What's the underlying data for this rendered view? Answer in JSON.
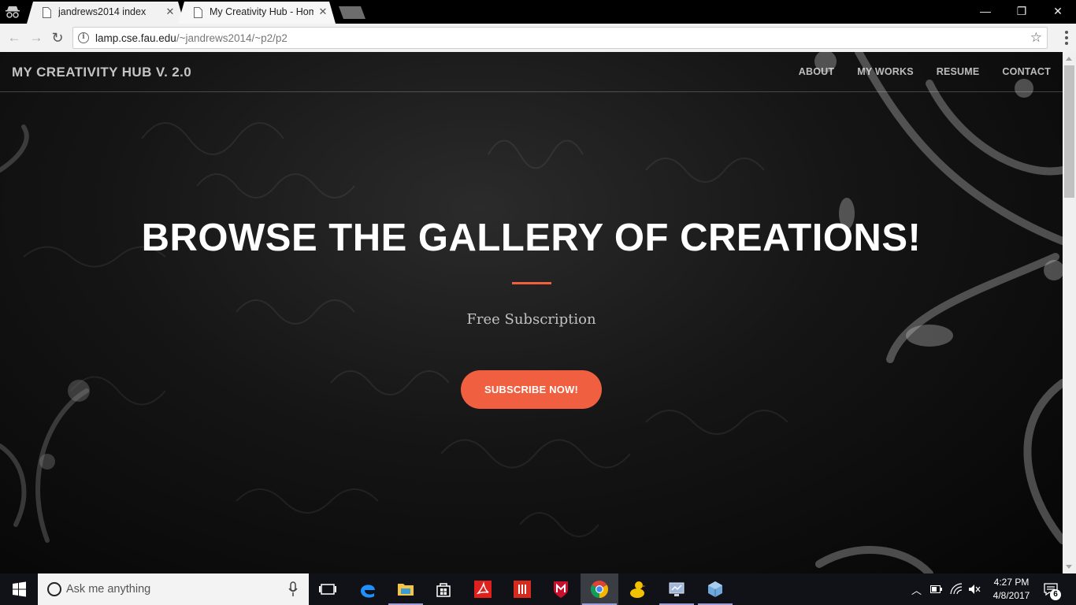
{
  "browser": {
    "tabs": [
      {
        "title": "jandrews2014 index",
        "active": false
      },
      {
        "title": "My Creativity Hub - Hom",
        "active": true
      }
    ],
    "address": {
      "host": "lamp.cse.fau.edu",
      "path": "/~jandrews2014/~p2/p2"
    },
    "window_controls": {
      "minimize": "—",
      "maximize": "❐",
      "close": "✕"
    }
  },
  "site": {
    "brand": "MY CREATIVITY HUB V. 2.0",
    "nav": [
      "ABOUT",
      "MY WORKS",
      "RESUME",
      "CONTACT"
    ],
    "hero": {
      "title": "BROWSE THE GALLERY OF CREATIONS!",
      "subtitle": "Free Subscription",
      "cta": "SUBSCRIBE NOW!"
    },
    "colors": {
      "accent": "#f05f40",
      "background": "#111111"
    }
  },
  "taskbar": {
    "search_placeholder": "Ask me anything",
    "apps": [
      "task-view-icon",
      "edge-icon",
      "file-explorer-icon",
      "store-icon",
      "adobe-acrobat-icon",
      "office-app-icon",
      "mcafee-icon",
      "chrome-icon",
      "duck-app-icon",
      "network-app-icon",
      "virtualbox-icon"
    ],
    "time": "4:27 PM",
    "date": "4/8/2017",
    "notification_count": "6"
  }
}
